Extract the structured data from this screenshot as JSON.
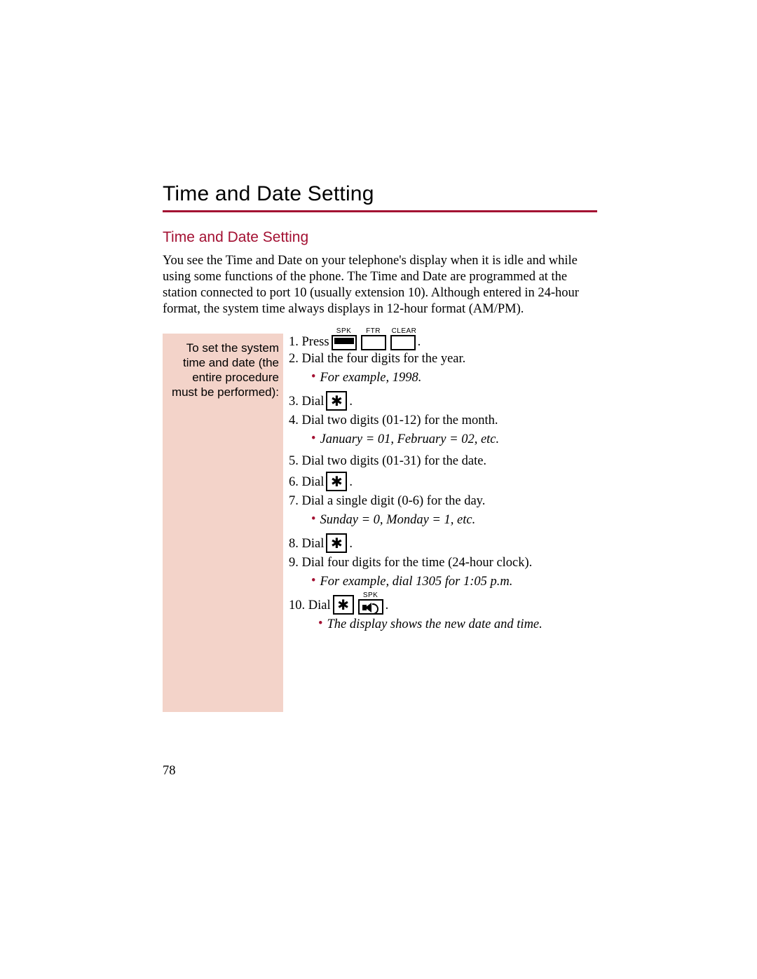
{
  "title": "Time and Date Setting",
  "subtitle": "Time and Date Setting",
  "intro": "You see the Time and Date on your telephone's display when it is idle and while using some functions of the phone. The Time and Date are programmed at the station connected to port 10 (usually extension 10). Although entered in 24-hour format, the system time always displays in 12-hour format (AM/PM).",
  "sidebar": "To set the system time and date (the entire procedure must be performed):",
  "keys": {
    "spk": "SPK",
    "ftr": "FTR",
    "clear": "CLEAR"
  },
  "steps": {
    "s1_pre": "1. Press ",
    "s1_post": ".",
    "s2": "2. Dial the four digits for the year.",
    "n2": "For example, 1998.",
    "s3_pre": "3. Dial ",
    "s3_post": ".",
    "s4": "4. Dial two digits (01-12) for the month.",
    "n4": "January = 01, February = 02, etc.",
    "s5": "5. Dial two digits (01-31) for the date.",
    "s6_pre": "6. Dial ",
    "s6_post": ".",
    "s7": "7. Dial a single digit (0-6) for the day.",
    "n7": "Sunday = 0, Monday = 1, etc.",
    "s8_pre": "8. Dial ",
    "s8_post": ".",
    "s9": "9. Dial four digits for the time (24-hour clock).",
    "n9": "For example, dial 1305 for 1:05 p.m.",
    "s10_pre": "10. Dial ",
    "s10_post": ".",
    "n10": "The display shows the new date and time."
  },
  "page_number": "78"
}
